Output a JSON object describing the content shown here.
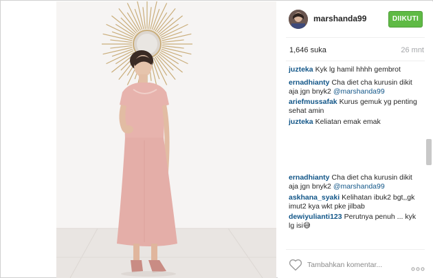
{
  "post": {
    "username": "marshanda99",
    "follow_label": "DIIKUTI",
    "likes": "1,646 suka",
    "time": "26 mnt"
  },
  "comments": [
    {
      "user": "juzteka",
      "text": "Kyk lg hamil hhhh gembrot",
      "mention": ""
    },
    {
      "user": "ernadhianty",
      "text": "Cha diet cha kurusin dikit aja jgn bnyk2",
      "mention": "@marshanda99"
    },
    {
      "user": "ariefmussafak",
      "text": "Kurus gemuk yg penting sehat amin",
      "mention": ""
    },
    {
      "user": "juzteka",
      "text": "Keliatan emak emak",
      "mention": ""
    },
    {
      "user": "ernadhianty",
      "text": "Cha diet cha kurusin dikit aja jgn bnyk2",
      "mention": "@marshanda99"
    },
    {
      "user": "askhana_syaki",
      "text": "Kelihatan ibuk2 bgt,,gk imut2 kya wkt pke jilbab",
      "mention": ""
    },
    {
      "user": "dewiyulianti123",
      "text": "Perutnya penuh ... kyk lg isi😅",
      "mention": ""
    }
  ],
  "footer": {
    "add_comment_placeholder": "Tambahkan komentar...",
    "like_icon": "heart-outline-icon",
    "more_icon": "more-options-icon"
  },
  "colors": {
    "follow_green": "#5fba45",
    "username_blue": "#125688",
    "dress_pink": "#e8b4ae"
  }
}
